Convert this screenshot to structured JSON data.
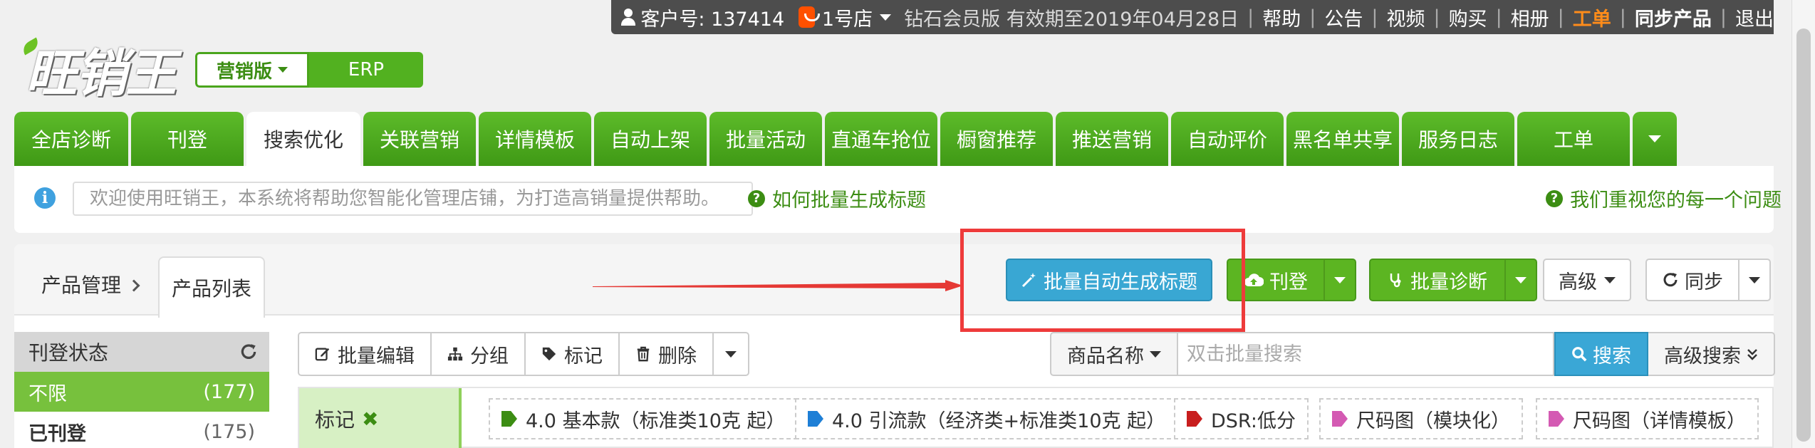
{
  "topbar": {
    "customer": "客户号: 137414",
    "shop": "1号店",
    "membership": "钻石会员版 有效期至2019年04月28日",
    "links": [
      "帮助",
      "公告",
      "视频",
      "购买",
      "相册"
    ],
    "ticket": "工单",
    "sync_products": "同步产品",
    "logout": "退出"
  },
  "logo": {
    "text": "旺销王"
  },
  "version": {
    "marketing": "营销版",
    "erp": "ERP"
  },
  "nav": {
    "tabs": [
      "全店诊断",
      "刊登",
      "搜索优化",
      "关联营销",
      "详情模板",
      "自动上架",
      "批量活动",
      "直通车抢位",
      "橱窗推荐",
      "推送营销",
      "自动评价",
      "黑名单共享",
      "服务日志",
      "工单"
    ],
    "active": "搜索优化"
  },
  "notice": {
    "message": "欢迎使用旺销王，本系统将帮助您智能化管理店铺，为打造高销量提供帮助。",
    "help_link": "如何批量生成标题",
    "feedback_link": "我们重视您的每一个问题"
  },
  "panel": {
    "breadcrumb": "产品管理",
    "subtab": "产品列表",
    "buttons": {
      "auto_title": "批量自动生成标题",
      "publish": "刊登",
      "diagnose": "批量诊断",
      "advanced": "高级",
      "sync": "同步"
    }
  },
  "filter": {
    "title": "刊登状态",
    "items": [
      {
        "label": "不限",
        "count": "(177)"
      },
      {
        "label": "已刊登",
        "count": "(175)"
      }
    ]
  },
  "toolbar": {
    "batch_edit": "批量编辑",
    "group": "分组",
    "mark": "标记",
    "delete": "删除"
  },
  "search": {
    "field": "商品名称",
    "placeholder": "双击批量搜索",
    "button": "搜索",
    "advanced": "高级搜索"
  },
  "tags": {
    "label": "标记",
    "items": [
      {
        "text": "4.0 基本款（标准类10克 起）",
        "color": "#3c8d13"
      },
      {
        "text": "4.0 引流款（经济类+标准类10克 起）",
        "color": "#1e7fd6"
      },
      {
        "text": "DSR:低分",
        "color": "#c81e1e"
      },
      {
        "text": "尺码图（模块化）",
        "color": "#d45ab3"
      },
      {
        "text": "尺码图（详情模板）",
        "color": "#d45ab3"
      }
    ]
  }
}
